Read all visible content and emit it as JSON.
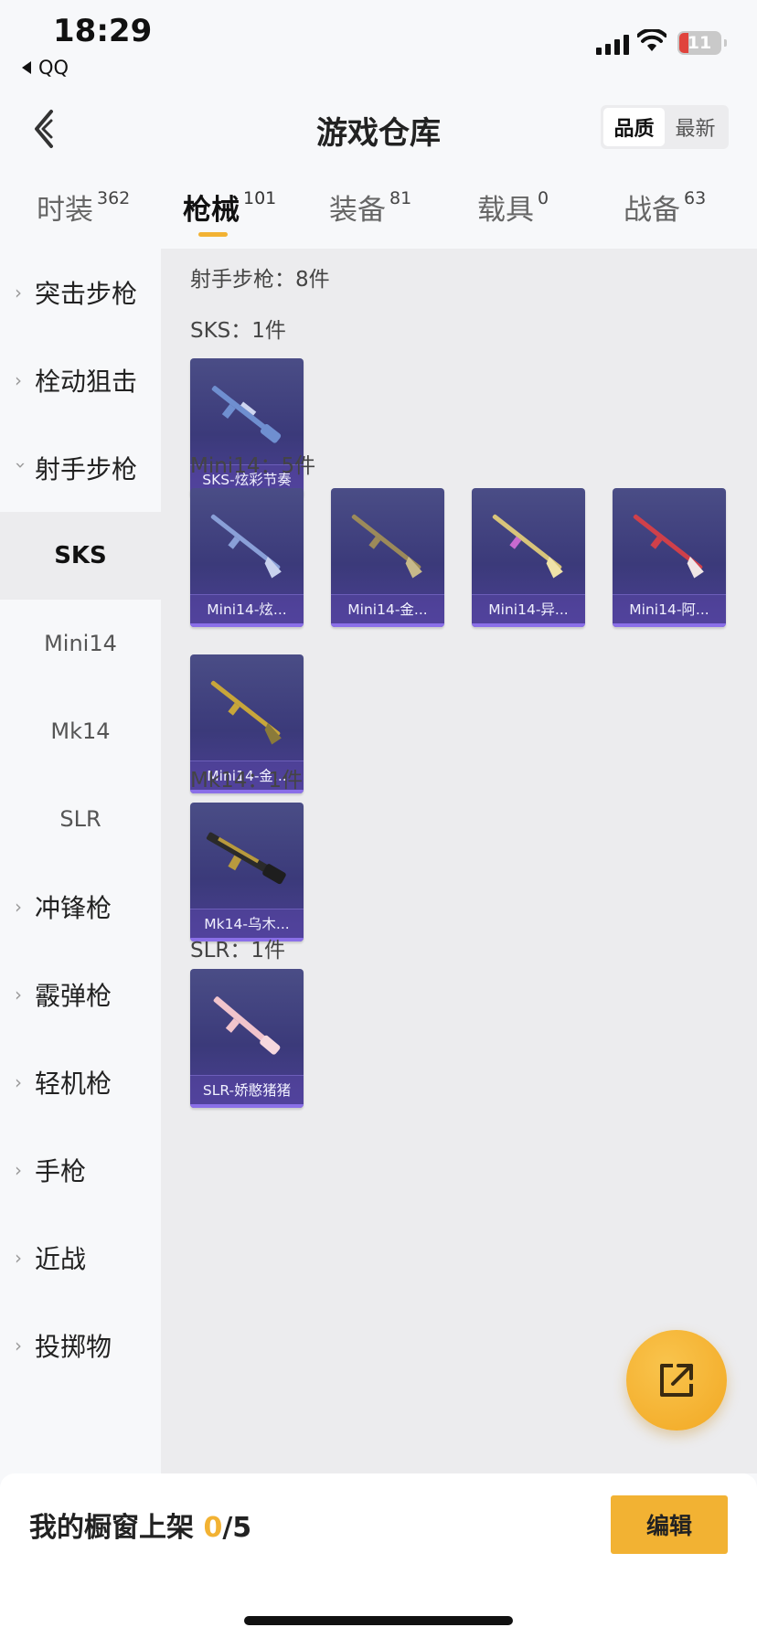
{
  "status": {
    "time": "18:29",
    "back_app": "QQ",
    "battery": "11"
  },
  "header": {
    "title": "游戏仓库",
    "sort": [
      "品质",
      "最新"
    ],
    "sort_active": 0
  },
  "tabs": [
    {
      "label": "时装",
      "count": "362"
    },
    {
      "label": "枪械",
      "count": "101"
    },
    {
      "label": "装备",
      "count": "81"
    },
    {
      "label": "载具",
      "count": "0"
    },
    {
      "label": "战备",
      "count": "63"
    }
  ],
  "active_tab": 1,
  "sidebar": {
    "categories": [
      "突击步枪",
      "栓动狙击",
      "射手步枪",
      "冲锋枪",
      "霰弹枪",
      "轻机枪",
      "手枪",
      "近战",
      "投掷物"
    ],
    "expanded": "射手步枪",
    "subitems": [
      "SKS",
      "Mini14",
      "Mk14",
      "SLR"
    ],
    "active_sub": "SKS"
  },
  "content": {
    "heading": "射手步枪：8件",
    "groups": [
      {
        "title": "SKS：1件",
        "items": [
          "SKS-炫彩节奏"
        ]
      },
      {
        "title": "Mini14：5件",
        "items": [
          "Mini14-炫...",
          "Mini14-金...",
          "Mini14-异...",
          "Mini14-阿...",
          "Mini14-金..."
        ]
      },
      {
        "title": "Mk14：1件",
        "items": [
          "Mk14-乌木..."
        ]
      },
      {
        "title": "SLR：1件",
        "items": [
          "SLR-娇憨猪猪"
        ]
      }
    ],
    "skin_colors": {
      "sks": "#6f8fd0",
      "mini_a": "#8aa0d8",
      "mini_b": "#9c8a5a",
      "mini_c": "#d8c47a",
      "mini_d": "#d0404a",
      "mini_e": "#c8a63a",
      "mk14": "#b89a3e",
      "slr": "#f1c4cc"
    }
  },
  "bottom": {
    "showcase_label": "我的橱窗上架",
    "current": "0",
    "total": "/5",
    "edit_label": "编辑"
  },
  "icons": {
    "fab": "share-export-icon"
  },
  "accent": "#f2b233"
}
